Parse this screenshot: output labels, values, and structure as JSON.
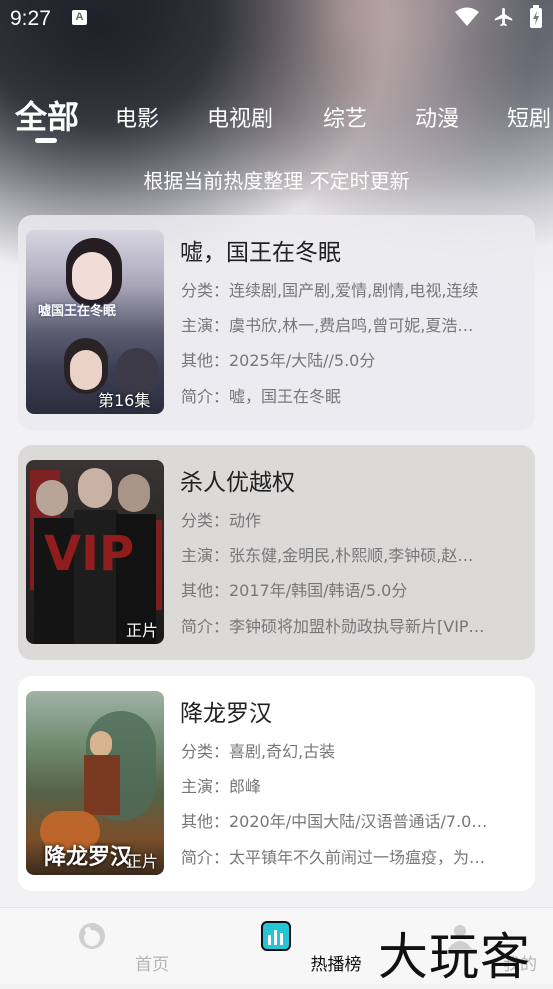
{
  "status_bar": {
    "time": "9:27",
    "notification_letter": "A",
    "icons": [
      "wifi-icon",
      "airplane-icon",
      "battery-charging-icon"
    ]
  },
  "tabs": [
    {
      "label": "全部",
      "active": true
    },
    {
      "label": "电影",
      "active": false
    },
    {
      "label": "电视剧",
      "active": false
    },
    {
      "label": "综艺",
      "active": false
    },
    {
      "label": "动漫",
      "active": false
    },
    {
      "label": "短剧",
      "active": false
    }
  ],
  "subtitle": "根据当前热度整理 不定时更新",
  "items": [
    {
      "title": "嘘，国王在冬眠",
      "category": "分类：连续剧,国产剧,爱情,剧情,电视,连续",
      "cast": "主演：虞书欣,林一,费启鸣,曾可妮,夏浩…",
      "other": "其他：2025年/大陆//5.0分",
      "intro": "简介：嘘，国王在冬眠",
      "badge": "第16集",
      "poster_text": "嘘国王在冬眠"
    },
    {
      "title": "杀人优越权",
      "category": "分类：动作",
      "cast": "主演：张东健,金明民,朴熙顺,李钟硕,赵…",
      "other": "其他：2017年/韩国/韩语/5.0分",
      "intro": "简介：李钟硕将加盟朴勋政执导新片[VIP…",
      "badge": "正片",
      "poster_text": "VIP"
    },
    {
      "title": "降龙罗汉",
      "category": "分类：喜剧,奇幻,古装",
      "cast": "主演：郎峰",
      "other": "其他：2020年/中国大陆/汉语普通话/7.0…",
      "intro": "简介：太平镇年不久前闹过一场瘟疫，为…",
      "badge": "正片",
      "poster_text": "降龙罗汉"
    }
  ],
  "bottom_nav": [
    {
      "label": "首页",
      "icon": "home-icon",
      "active": false
    },
    {
      "label": "热播榜",
      "icon": "chart-icon",
      "active": true
    },
    {
      "label": "我的",
      "icon": "user-icon",
      "active": false
    }
  ],
  "watermark": "大玩客",
  "colors": {
    "active_nav": "#111111",
    "inactive_nav": "#b5b5b5",
    "chart_icon": "#25c4d6"
  }
}
